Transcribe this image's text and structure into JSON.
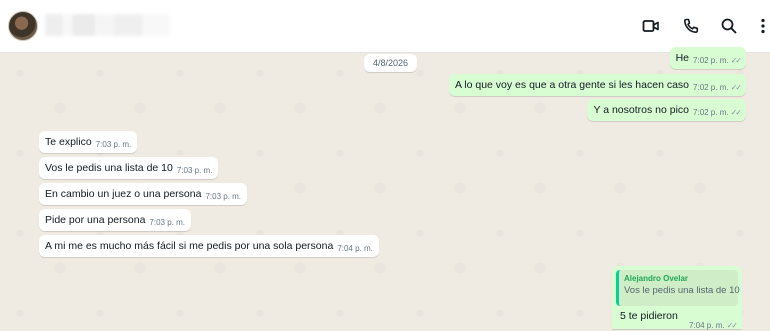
{
  "header": {
    "contact_name": "",
    "icons": [
      "video-call-icon",
      "voice-call-icon",
      "search-icon",
      "menu-icon"
    ]
  },
  "date_chip": "4/8/2026",
  "messages": [
    {
      "dir": "out",
      "text": "He",
      "time": "7:02 p. m."
    },
    {
      "dir": "out",
      "text": "A lo que voy es que a otra gente si les hacen caso",
      "time": "7:02 p. m."
    },
    {
      "dir": "out",
      "text": "Y a nosotros no pico",
      "time": "7:02 p. m."
    },
    {
      "dir": "in",
      "text": "Te explico",
      "time": "7:03 p. m."
    },
    {
      "dir": "in",
      "text": "Vos le pedis una lista de 10",
      "time": "7:03 p. m."
    },
    {
      "dir": "in",
      "text": "En cambio un juez o una persona",
      "time": "7:03 p. m."
    },
    {
      "dir": "in",
      "text": "Pide por una persona",
      "time": "7:03 p. m."
    },
    {
      "dir": "in",
      "text": "A mi me es mucho más fácil si me pedis por una sola persona",
      "time": "7:04 p. m."
    }
  ],
  "reply": {
    "quoted_author": "Alejandro Ovelar",
    "quoted_text": "Vos le pedis una lista de 10",
    "text": "5 te pidieron",
    "time": "7:04 p. m."
  },
  "colors": {
    "outgoing_bubble": "#d9fdd3",
    "incoming_bubble": "#ffffff",
    "chat_background": "#efeae2",
    "quote_accent": "#06cf9c"
  }
}
